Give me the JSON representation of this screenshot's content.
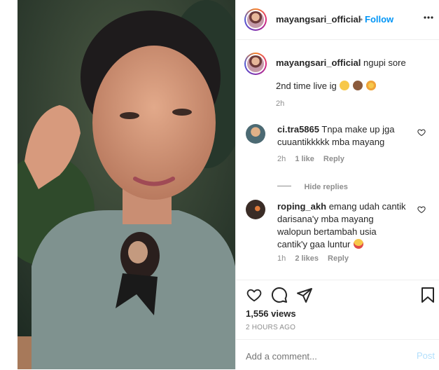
{
  "header": {
    "username": "mayangsari_official",
    "separator": "•",
    "follow_label": "Follow",
    "more_icon": "more-horizontal-icon"
  },
  "caption": {
    "username": "mayangsari_official",
    "text": "ngupi sore",
    "line2": "2nd time live ig",
    "emojis": [
      "grinning-face",
      "see-no-evil-monkey",
      "smiling-face-with-hearts"
    ],
    "time": "2h"
  },
  "comments": [
    {
      "username": "ci.tra5865",
      "text_lines": [
        "Tnpa make up jga",
        "cuuantikkkkk mba mayang"
      ],
      "time": "2h",
      "likes": "1 like",
      "reply_label": "Reply"
    },
    {
      "username": "roping_akh",
      "text_lines": [
        "emang udah cantik",
        "darisana'y mba mayang",
        "walopun bertambah usia",
        "cantik'y gaa luntur"
      ],
      "emoji": "heart-eyes-face",
      "time": "1h",
      "likes": "2 likes",
      "reply_label": "Reply"
    }
  ],
  "hide_replies_label": "Hide replies",
  "stats": {
    "views": "1,556 views",
    "timestamp": "2 HOURS AGO"
  },
  "comment_box": {
    "placeholder": "Add a comment...",
    "post_label": "Post"
  },
  "colors": {
    "accent": "#0095f6",
    "muted": "#8e8e8e",
    "text": "#262626",
    "divider": "#efefef"
  }
}
